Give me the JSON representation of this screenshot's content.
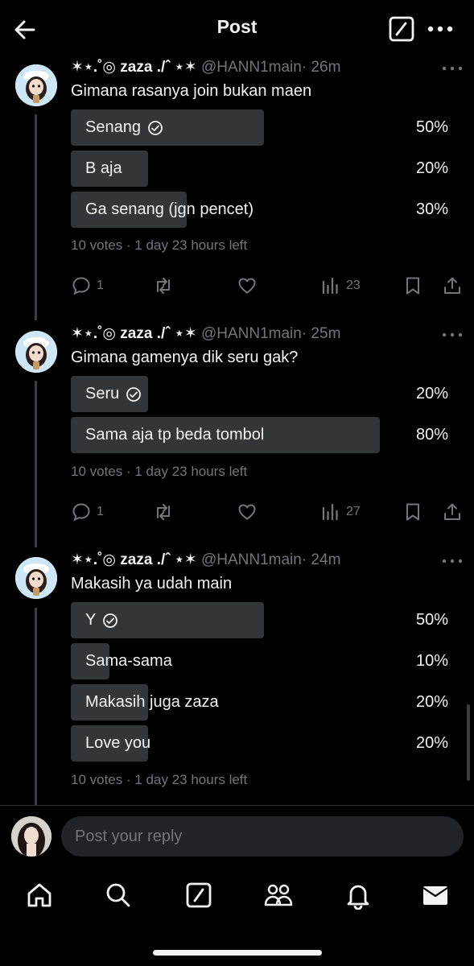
{
  "header": {
    "title": "Post",
    "back_icon": "arrow-left-icon",
    "compose_icon": "compose-icon",
    "more_icon": "more-horizontal-icon"
  },
  "colors": {
    "background": "#000000",
    "poll_bar": "#333639",
    "muted": "#71767b",
    "text": "#e7e9ea"
  },
  "posts": [
    {
      "display_name": "✶⋆.˚◎ zaza ./ˆ ⋆✶",
      "handle": "@HANN1main",
      "time": "· 26m",
      "text": "Gimana rasanya join bukan maen",
      "poll": [
        {
          "label": "Senang",
          "percent_text": "50%",
          "percent": 50,
          "winner": true
        },
        {
          "label": "B aja",
          "percent_text": "20%",
          "percent": 20,
          "winner": false
        },
        {
          "label": "Ga senang (jgn pencet)",
          "percent_text": "30%",
          "percent": 30,
          "winner": false
        }
      ],
      "votes": "10 votes · 1 day 23 hours left",
      "replies": "1",
      "views": "23"
    },
    {
      "display_name": "✶⋆.˚◎ zaza ./ˆ ⋆✶",
      "handle": "@HANN1main",
      "time": "· 25m",
      "text": "Gimana gamenya dik seru gak?",
      "poll": [
        {
          "label": "Seru",
          "percent_text": "20%",
          "percent": 20,
          "winner": true
        },
        {
          "label": "Sama aja tp beda tombol",
          "percent_text": "80%",
          "percent": 80,
          "winner": false
        }
      ],
      "votes": "10 votes · 1 day 23 hours left",
      "replies": "1",
      "views": "27"
    },
    {
      "display_name": "✶⋆.˚◎ zaza ./ˆ ⋆✶",
      "handle": "@HANN1main",
      "time": "· 24m",
      "text": "Makasih ya udah main",
      "poll": [
        {
          "label": "Y",
          "percent_text": "50%",
          "percent": 50,
          "winner": true
        },
        {
          "label": "Sama-sama",
          "percent_text": "10%",
          "percent": 10,
          "winner": false
        },
        {
          "label": "Makasih juga zaza",
          "percent_text": "20%",
          "percent": 20,
          "winner": false
        },
        {
          "label": "Love you",
          "percent_text": "20%",
          "percent": 20,
          "winner": false
        }
      ],
      "votes": "10 votes · 1 day 23 hours left"
    }
  ],
  "reply": {
    "placeholder": "Post your reply"
  },
  "tabs": [
    "home-icon",
    "search-icon",
    "compose-icon",
    "communities-icon",
    "notifications-icon",
    "messages-icon"
  ]
}
